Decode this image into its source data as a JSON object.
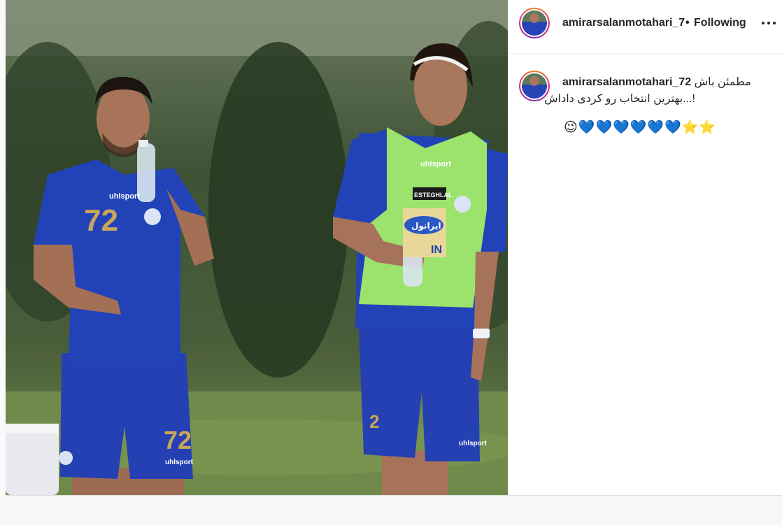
{
  "post": {
    "username": "amirarsalanmotahari_7",
    "separator": "•",
    "follow_status": "Following",
    "more_options_icon": "more-horizontal-icon",
    "caption": {
      "username": "amirarsalanmotahari_72",
      "line1_text": "مطمئن باش",
      "line2_text": "!...بهترین انتخاب رو کردی داداش",
      "emoji_line": "😉💙💙💙💙💙💙⭐⭐"
    }
  },
  "photo": {
    "player_left_number": "72",
    "player_left_shorts_number": "72",
    "sponsor_brand": "uhlsport",
    "bib_text": "ESTEGHLAL",
    "bib_sponsor_text": "ایرانول",
    "bib_sponsor_sub": "IN",
    "colors": {
      "kit_blue": "#1f3fae",
      "bib_green": "#9be36c",
      "number_gold": "#c9a55a",
      "grass": "#6f8a4a"
    }
  }
}
